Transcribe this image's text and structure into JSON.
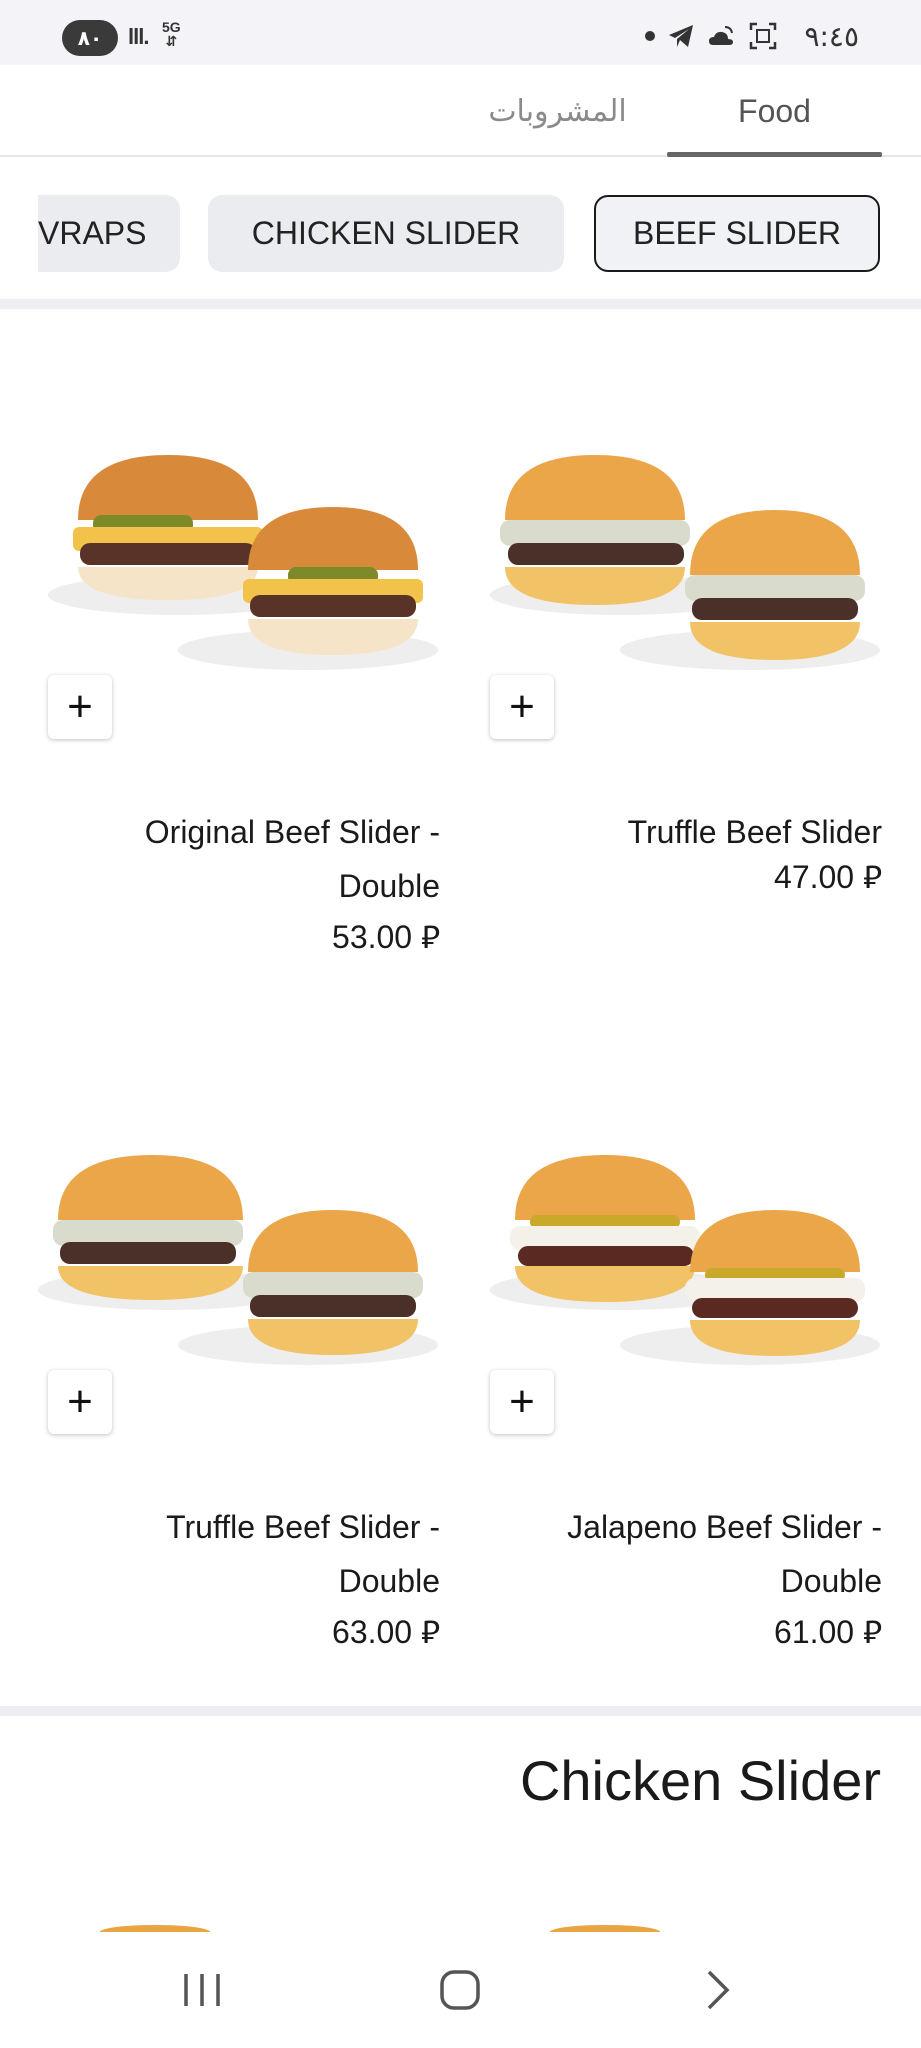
{
  "status_bar": {
    "battery": "٨٠",
    "signal": "lll.",
    "network": "5G",
    "time": "٩:٤٥"
  },
  "tabs": [
    {
      "label": "المشروبات",
      "active": false
    },
    {
      "label": "Food",
      "active": true
    }
  ],
  "categories": [
    {
      "label": "WRAPS",
      "visible_label": "VRAPS",
      "selected": false
    },
    {
      "label": "CHICKEN SLIDER",
      "selected": false
    },
    {
      "label": "BEEF SLIDER",
      "selected": true
    }
  ],
  "products": [
    {
      "name": "Original Beef Slider - Double",
      "name_line1": "Original Beef Slider -",
      "name_line2": "Double",
      "price": "53.00",
      "currency_symbol": "⃁"
    },
    {
      "name": "Truffle Beef Slider",
      "price": "47.00",
      "currency_symbol": "⃁"
    },
    {
      "name": "Truffle Beef Slider - Double",
      "name_line1": "Truffle Beef Slider -",
      "name_line2": "Double",
      "price": "63.00",
      "currency_symbol": "⃁"
    },
    {
      "name": "Jalapeno Beef Slider - Double",
      "name_line1": "Jalapeno Beef Slider -",
      "name_line2": "Double",
      "price": "61.00",
      "currency_symbol": "⃁"
    }
  ],
  "add_button_label": "+",
  "next_section_title": "Chicken Slider",
  "colors": {
    "accent": "#1a1a1a",
    "chip_bg": "#ebecf0",
    "divider": "#eeeef2",
    "bun": "#e8a542"
  }
}
